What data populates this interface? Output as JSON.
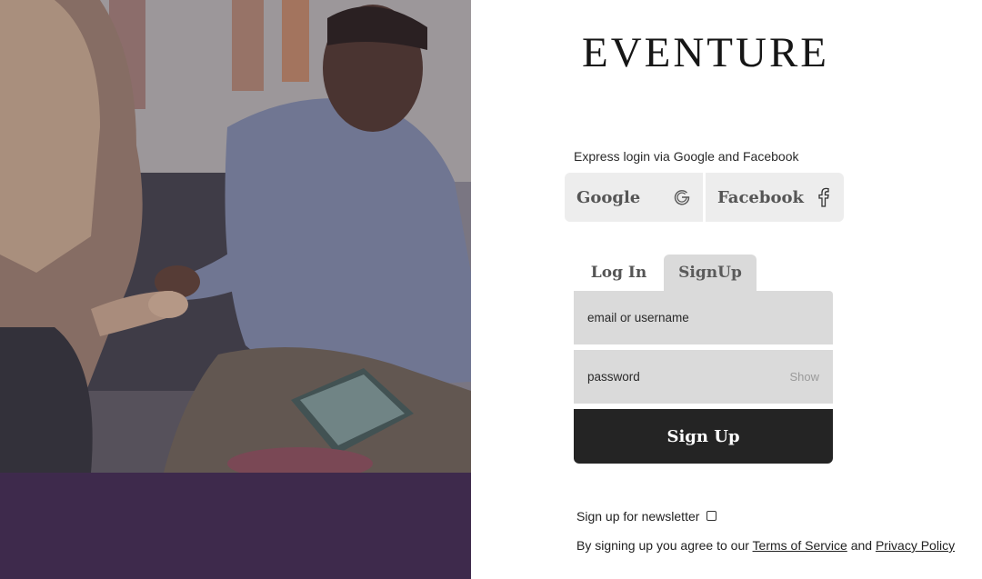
{
  "brand": {
    "name": "EVENTURE"
  },
  "express_login": {
    "label": "Express login via Google and Facebook",
    "google": {
      "label": "Google",
      "icon": "google-icon"
    },
    "facebook": {
      "label": "Facebook",
      "icon": "facebook-icon"
    }
  },
  "tabs": [
    {
      "label": "Log In",
      "active": false
    },
    {
      "label": "SignUp",
      "active": true
    }
  ],
  "form": {
    "email_placeholder": "email or username",
    "email_value": "",
    "password_placeholder": "password",
    "password_value": "",
    "show_label": "Show",
    "submit_label": "Sign Up"
  },
  "newsletter": {
    "label": "Sign up for newsletter",
    "checked": false
  },
  "terms": {
    "prefix": "By signing up you agree to our",
    "tos_link": "Terms of Service",
    "conjunction": "and",
    "privacy_link": "Privacy Policy"
  },
  "colors": {
    "footer_purple": "#3e2a4c",
    "button_dark": "#242424",
    "field_gray": "#dadada",
    "social_gray": "#ededed"
  }
}
